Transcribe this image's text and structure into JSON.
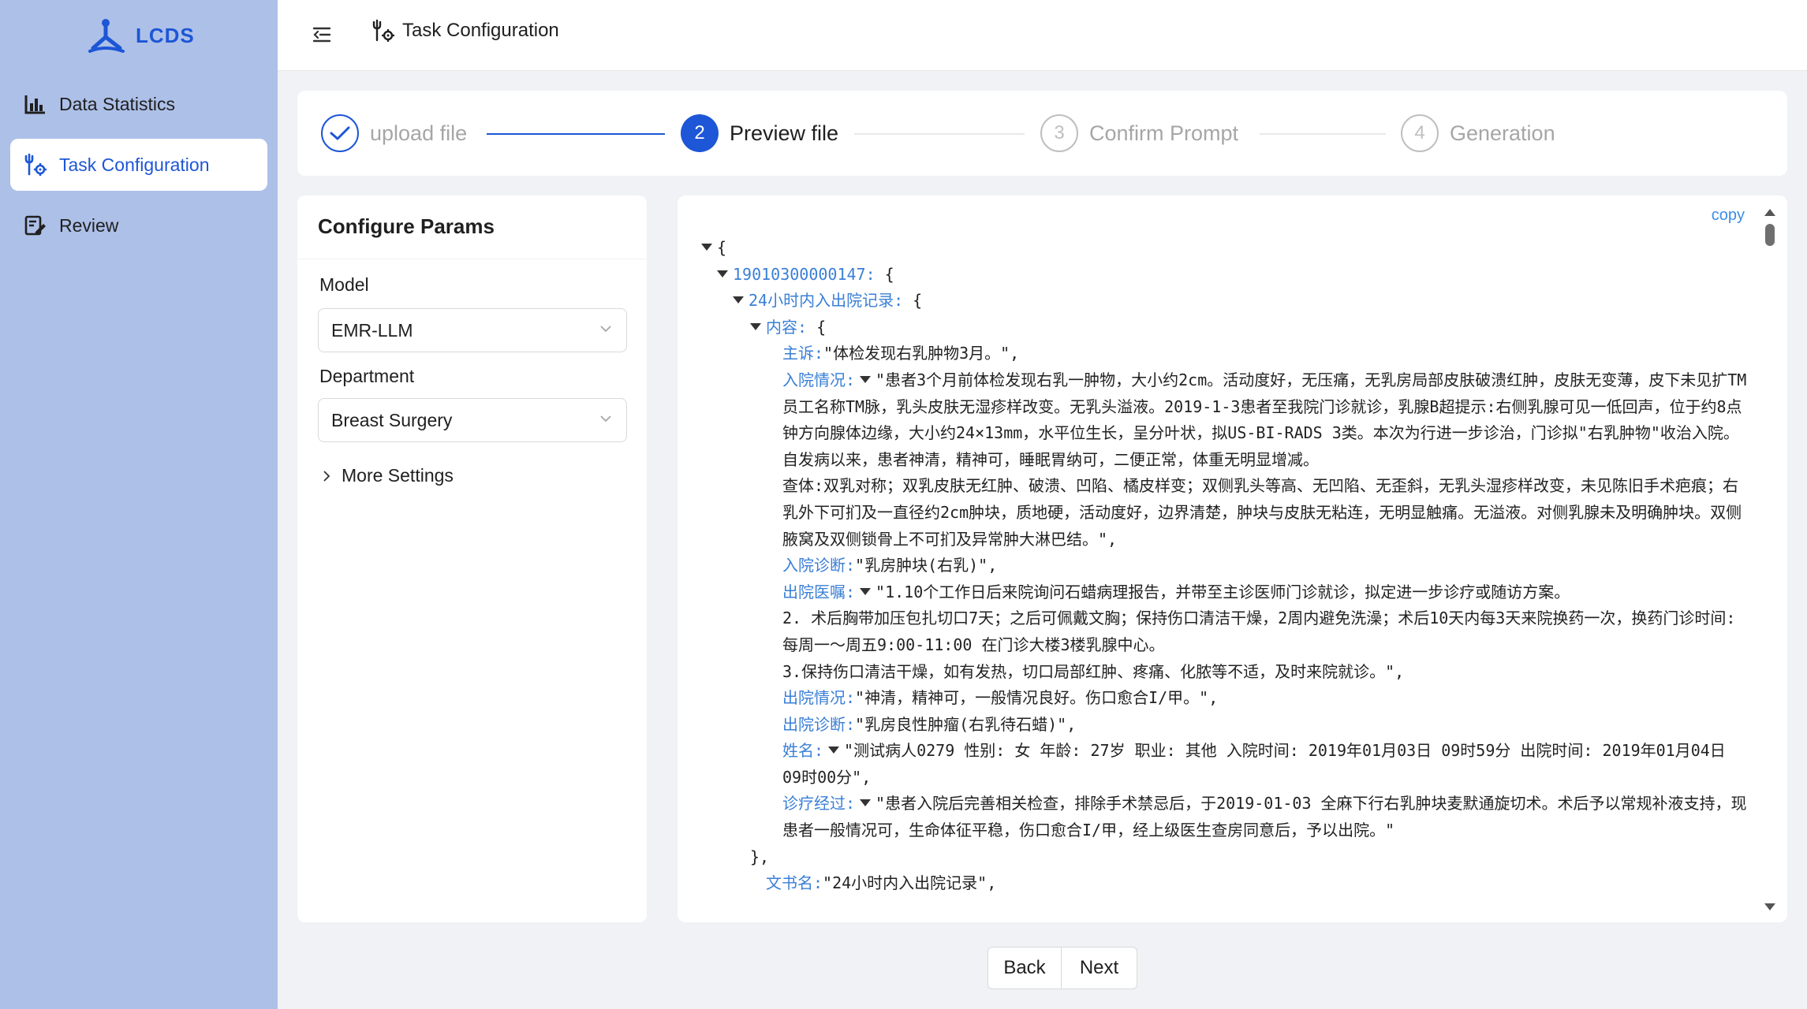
{
  "app": {
    "name": "LCDS"
  },
  "nav": {
    "items": [
      {
        "label": "Data Statistics",
        "icon": "bar-chart-icon"
      },
      {
        "label": "Task Configuration",
        "icon": "tools-icon",
        "active": true
      },
      {
        "label": "Review",
        "icon": "edit-icon"
      }
    ]
  },
  "header": {
    "title": "Task Configuration"
  },
  "steps": [
    {
      "label": "upload file",
      "state": "done"
    },
    {
      "num": "2",
      "label": "Preview file",
      "state": "current"
    },
    {
      "num": "3",
      "label": "Confirm Prompt",
      "state": "wait"
    },
    {
      "num": "4",
      "label": "Generation",
      "state": "wait"
    }
  ],
  "config": {
    "title": "Configure Params",
    "model_label": "Model",
    "model_value": "EMR-LLM",
    "department_label": "Department",
    "department_value": "Breast Surgery",
    "more_settings": "More Settings"
  },
  "json_viewer": {
    "copy": "copy",
    "open_brace": "{",
    "record_id_key": "19010300000147:",
    "record_title_key": "24小时内入出院记录:",
    "content_key": "内容:",
    "chief_complaint_key": "主诉:",
    "chief_complaint_value": "\"体检发现右乳肿物3月。\",",
    "admission_key": "入院情况:",
    "admission_value": "\"患者3个月前体检发现右乳一肿物，大小约2cm。活动度好，无压痛，无乳房局部皮肤破溃红肿，皮肤无变薄，皮下未见扩TM员工名称TM脉，乳头皮肤无湿疹样改变。无乳头溢液。2019-1-3患者至我院门诊就诊，乳腺B超提示:右侧乳腺可见一低回声，位于约8点钟方向腺体边缘，大小约24×13mm，水平位生长，呈分叶状，拟US-BI-RADS 3类。本次为行进一步诊治，门诊拟\"右乳肿物\"收治入院。",
    "admission_line2": "自发病以来，患者神清，精神可，睡眠胃纳可，二便正常，体重无明显增减。",
    "admission_line3": "查体:双乳对称；双乳皮肤无红肿、破溃、凹陷、橘皮样变；双侧乳头等高、无凹陷、无歪斜，无乳头湿疹样改变，未见陈旧手术疤痕；右乳外下可扪及一直径约2cm肿块，质地硬，活动度好，边界清楚，肿块与皮肤无粘连，无明显触痛。无溢液。对侧乳腺未及明确肿块。双侧腋窝及双侧锁骨上不可扪及异常肿大淋巴结。\",",
    "admission_dx_key": "入院诊断:",
    "admission_dx_value": "\"乳房肿块(右乳)\",",
    "discharge_orders_key": "出院医嘱:",
    "discharge_orders_value": "\"1.10个工作日后来院询问石蜡病理报告，并带至主诊医师门诊就诊，拟定进一步诊疗或随访方案。",
    "discharge_orders_line2": "2. 术后胸带加压包扎切口7天；之后可佩戴文胸；保持伤口清洁干燥，2周内避免洗澡；术后10天内每3天来院换药一次，换药门诊时间:每周一～周五9:00-11:00 在门诊大楼3楼乳腺中心。",
    "discharge_orders_line3": "3.保持伤口清洁干燥，如有发热，切口局部红肿、疼痛、化脓等不适，及时来院就诊。\",",
    "discharge_status_key": "出院情况:",
    "discharge_status_value": "\"神清，精神可，一般情况良好。伤口愈合I/甲。\",",
    "discharge_dx_key": "出院诊断:",
    "discharge_dx_value": "\"乳房良性肿瘤(右乳待石蜡)\",",
    "name_key": "姓名:",
    "name_value": "\"测试病人0279 性别: 女 年龄: 27岁 职业: 其他 入院时间: 2019年01月03日 09时59分 出院时间: 2019年01月04日 09时00分\",",
    "course_key": "诊疗经过:",
    "course_value": "\"患者入院后完善相关检查，排除手术禁忌后，于2019-01-03 全麻下行右乳肿块麦默通旋切术。术后予以常规补液支持，现患者一般情况可，生命体征平稳，伤口愈合I/甲，经上级医生查房同意后，予以出院。\"",
    "close_brace": "},",
    "doc_name_key": "文书名:",
    "doc_name_value": "\"24小时内入出院记录\","
  },
  "footer": {
    "back": "Back",
    "next": "Next"
  },
  "colors": {
    "primary": "#1d56d6",
    "sidebar_bg": "#adc0e8",
    "json_key": "#3a7fd6"
  }
}
